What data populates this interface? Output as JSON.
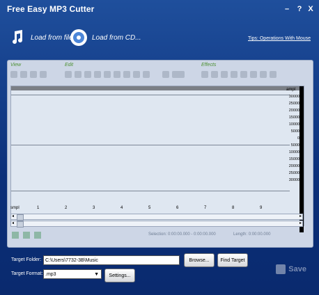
{
  "window": {
    "title": "Free Easy MP3 Cutter",
    "buttons": {
      "minimize": "–",
      "help": "?",
      "close": "X"
    }
  },
  "header": {
    "load_file_label": "Load from file...",
    "load_cd_label": "Load from CD...",
    "tips_link": "Tips: Operations With Mouse"
  },
  "toolbar": {
    "groups": {
      "view": "View",
      "edit": "Edit",
      "effects": "Effects"
    }
  },
  "waveform": {
    "amplitude_label": "ampl",
    "scale_ticks": [
      "30000",
      "25000",
      "20000",
      "15000",
      "10000",
      "5000",
      "0",
      "5000",
      "10000",
      "15000",
      "20000",
      "25000",
      "30000"
    ],
    "ruler_label": "smpl",
    "ruler_ticks": [
      "1",
      "2",
      "3",
      "4",
      "5",
      "6",
      "7",
      "8",
      "9"
    ]
  },
  "status": {
    "selection_label": "Selection:",
    "selection_value": "0:00:00.000 - 0:00:00.000",
    "length_label": "Length:",
    "length_value": "0:00:00.000"
  },
  "output": {
    "target_folder_label": "Target Folder:",
    "target_folder_value": "C:\\Users\\7732-3B\\Music",
    "browse_label": "Browse...",
    "find_target_label": "Find Target",
    "target_format_label": "Target Format:",
    "target_format_value": ".mp3",
    "settings_label": "Settings...",
    "save_label": "Save"
  },
  "colors": {
    "window_bg": "#0b2f7a",
    "panel_bg": "#cdd6e6",
    "wave_bg": "#dfe7f1",
    "accent_green": "#4a8f2f"
  }
}
